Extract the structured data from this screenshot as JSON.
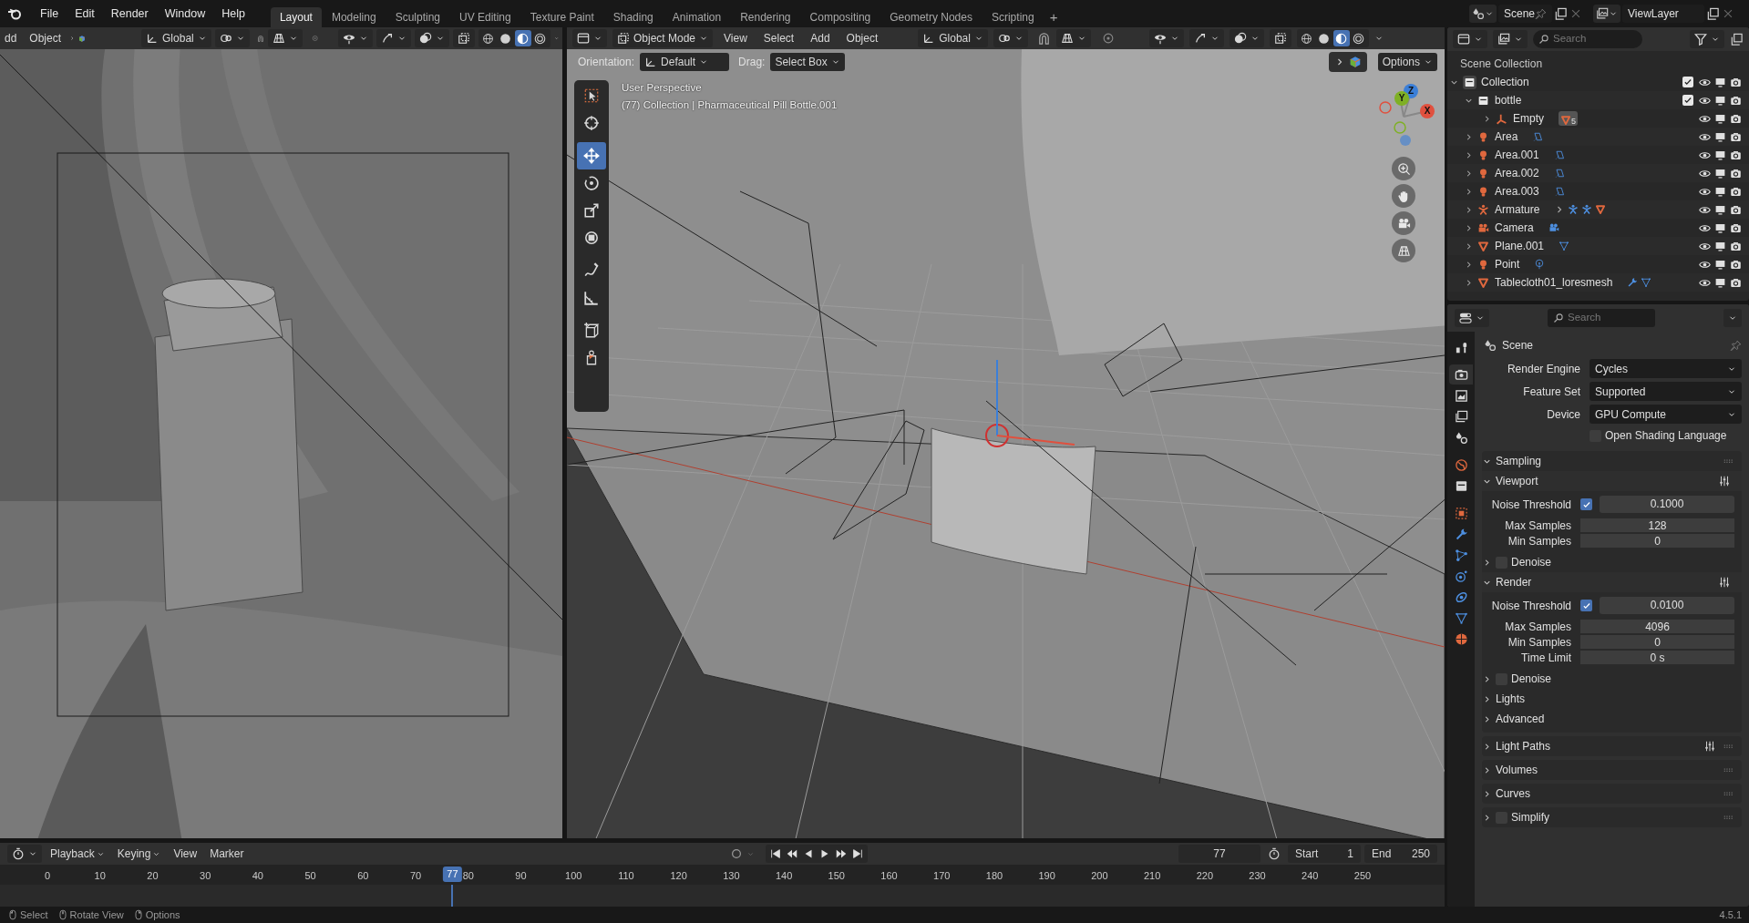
{
  "top_bar": {
    "menu": [
      "File",
      "Edit",
      "Render",
      "Window",
      "Help"
    ],
    "workspaces": [
      {
        "label": "Layout",
        "selected": true
      },
      {
        "label": "Modeling",
        "selected": false
      },
      {
        "label": "Sculpting",
        "selected": false
      },
      {
        "label": "UV Editing",
        "selected": false
      },
      {
        "label": "Texture Paint",
        "selected": false
      },
      {
        "label": "Shading",
        "selected": false
      },
      {
        "label": "Animation",
        "selected": false
      },
      {
        "label": "Rendering",
        "selected": false
      },
      {
        "label": "Compositing",
        "selected": false
      },
      {
        "label": "Geometry Nodes",
        "selected": false
      },
      {
        "label": "Scripting",
        "selected": false
      }
    ],
    "add_workspace": "+",
    "scene": "Scene",
    "view_layer": "ViewLayer"
  },
  "left_viewport": {
    "menu": [
      "dd",
      "Object"
    ],
    "orientation": "Global",
    "shading": [
      {
        "selected": false
      },
      {
        "selected": false
      },
      {
        "selected": true
      },
      {
        "selected": false
      }
    ]
  },
  "main_viewport": {
    "mode": "Object Mode",
    "menu": [
      "View",
      "Select",
      "Add",
      "Object"
    ],
    "orientation": "Global",
    "shading": [
      {
        "selected": false
      },
      {
        "selected": false
      },
      {
        "selected": true
      },
      {
        "selected": false
      }
    ],
    "tool_settings": {
      "orientation_label": "Orientation:",
      "orientation": "Default",
      "drag_label": "Drag:",
      "drag": "Select Box",
      "options": "Options"
    },
    "info": [
      "User Perspective",
      "(77) Collection | Pharmaceutical Pill Bottle.001"
    ],
    "tools": [
      {
        "kind": "select",
        "selected": false
      },
      {
        "kind": "cursor",
        "selected": false
      },
      {
        "kind": "move",
        "selected": true
      },
      {
        "kind": "rotate",
        "selected": false
      },
      {
        "kind": "scale",
        "selected": false
      },
      {
        "kind": "transform",
        "selected": false
      },
      {
        "kind": "annotate",
        "selected": false
      },
      {
        "kind": "measure",
        "selected": false
      },
      {
        "kind": "add_cube",
        "selected": false
      },
      {
        "kind": "add_object",
        "selected": false
      }
    ],
    "gizmo_axes": [
      {
        "label": "Z",
        "color": "#3b7fd8"
      },
      {
        "label": "Y",
        "color": "#7fb025"
      },
      {
        "label": "X",
        "color": "#e0503e"
      }
    ]
  },
  "outliner": {
    "search_placeholder": "Search",
    "root": "Scene Collection",
    "tree": [
      {
        "name": "Collection",
        "kind": "collection",
        "checked": true,
        "expanded": true,
        "children": [
          {
            "name": "bottle",
            "kind": "collection",
            "checked": true,
            "expanded": true,
            "children": [
              {
                "name": "Empty",
                "kind": "empty",
                "expanded": false,
                "badge": "5"
              }
            ]
          },
          {
            "name": "Area",
            "kind": "area_light",
            "expanded": false
          },
          {
            "name": "Area.001",
            "kind": "area_light",
            "expanded": false
          },
          {
            "name": "Area.002",
            "kind": "area_light",
            "expanded": false
          },
          {
            "name": "Area.003",
            "kind": "area_light",
            "expanded": false
          },
          {
            "name": "Armature",
            "kind": "armature",
            "expanded": false
          },
          {
            "name": "Camera",
            "kind": "camera",
            "expanded": false
          },
          {
            "name": "Plane.001",
            "kind": "mesh",
            "expanded": false
          },
          {
            "name": "Point",
            "kind": "point_light",
            "expanded": false
          },
          {
            "name": "Tablecloth01_loresmesh",
            "kind": "modified_mesh",
            "expanded": false
          }
        ]
      }
    ]
  },
  "properties": {
    "search_placeholder": "Search",
    "tabs": [
      {
        "kind": "tool",
        "selected": false
      },
      {
        "kind": "render",
        "selected": true
      },
      {
        "kind": "output",
        "selected": false
      },
      {
        "kind": "view_layer",
        "selected": false
      },
      {
        "kind": "scene",
        "selected": false
      },
      {
        "kind": "world",
        "selected": false
      },
      {
        "kind": "collection",
        "selected": false
      },
      {
        "kind": "object",
        "selected": false
      },
      {
        "kind": "modifiers",
        "selected": false
      },
      {
        "kind": "particles",
        "selected": false
      },
      {
        "kind": "physics",
        "selected": false
      },
      {
        "kind": "constraints",
        "selected": false
      },
      {
        "kind": "data",
        "selected": false
      },
      {
        "kind": "material",
        "selected": false
      }
    ],
    "context": "Scene",
    "fields": [
      {
        "label": "Render Engine",
        "value": "Cycles"
      },
      {
        "label": "Feature Set",
        "value": "Supported"
      },
      {
        "label": "Device",
        "value": "GPU Compute"
      }
    ],
    "osl": {
      "label": "Open Shading Language",
      "checked": false
    },
    "sampling": {
      "title": "Sampling",
      "expanded": true,
      "subpanels": [
        {
          "title": "Viewport",
          "expanded": true,
          "noise": {
            "label": "Noise Threshold",
            "checked": true,
            "value": "0.1000"
          },
          "rows": [
            {
              "label": "Max Samples",
              "value": "128"
            },
            {
              "label": "Min Samples",
              "value": "0"
            }
          ],
          "denoise": {
            "label": "Denoise",
            "checked": false,
            "expanded": false
          }
        },
        {
          "title": "Render",
          "expanded": true,
          "noise": {
            "label": "Noise Threshold",
            "checked": true,
            "value": "0.0100"
          },
          "rows": [
            {
              "label": "Max Samples",
              "value": "4096"
            },
            {
              "label": "Min Samples",
              "value": "0"
            },
            {
              "label": "Time Limit",
              "value": "0 s"
            }
          ],
          "denoise": {
            "label": "Denoise",
            "checked": false,
            "expanded": false
          }
        }
      ],
      "more": [
        {
          "title": "Lights",
          "expanded": false
        },
        {
          "title": "Advanced",
          "expanded": false
        }
      ]
    },
    "panels": [
      {
        "title": "Light Paths",
        "expanded": false,
        "presets": true
      },
      {
        "title": "Volumes",
        "expanded": false,
        "presets": false
      },
      {
        "title": "Curves",
        "expanded": false,
        "presets": false
      },
      {
        "title": "Simplify",
        "expanded": false,
        "presets": false,
        "checked": false
      }
    ]
  },
  "timeline": {
    "menu": [
      "Playback",
      "Keying",
      "View",
      "Marker"
    ],
    "current_frame": "77",
    "start_label": "Start",
    "start": "1",
    "end_label": "End",
    "end": "250",
    "ticks": [
      "0",
      "10",
      "20",
      "30",
      "40",
      "50",
      "60",
      "70",
      "80",
      "90",
      "100",
      "110",
      "120",
      "130",
      "140",
      "150",
      "160",
      "170",
      "180",
      "190",
      "200",
      "210",
      "220",
      "230",
      "240",
      "250"
    ],
    "playhead": {
      "label": "77",
      "level": 0.308
    }
  },
  "status_bar": {
    "hints": [
      "Select",
      "Rotate View",
      "Options"
    ],
    "version": "4.5.1"
  }
}
